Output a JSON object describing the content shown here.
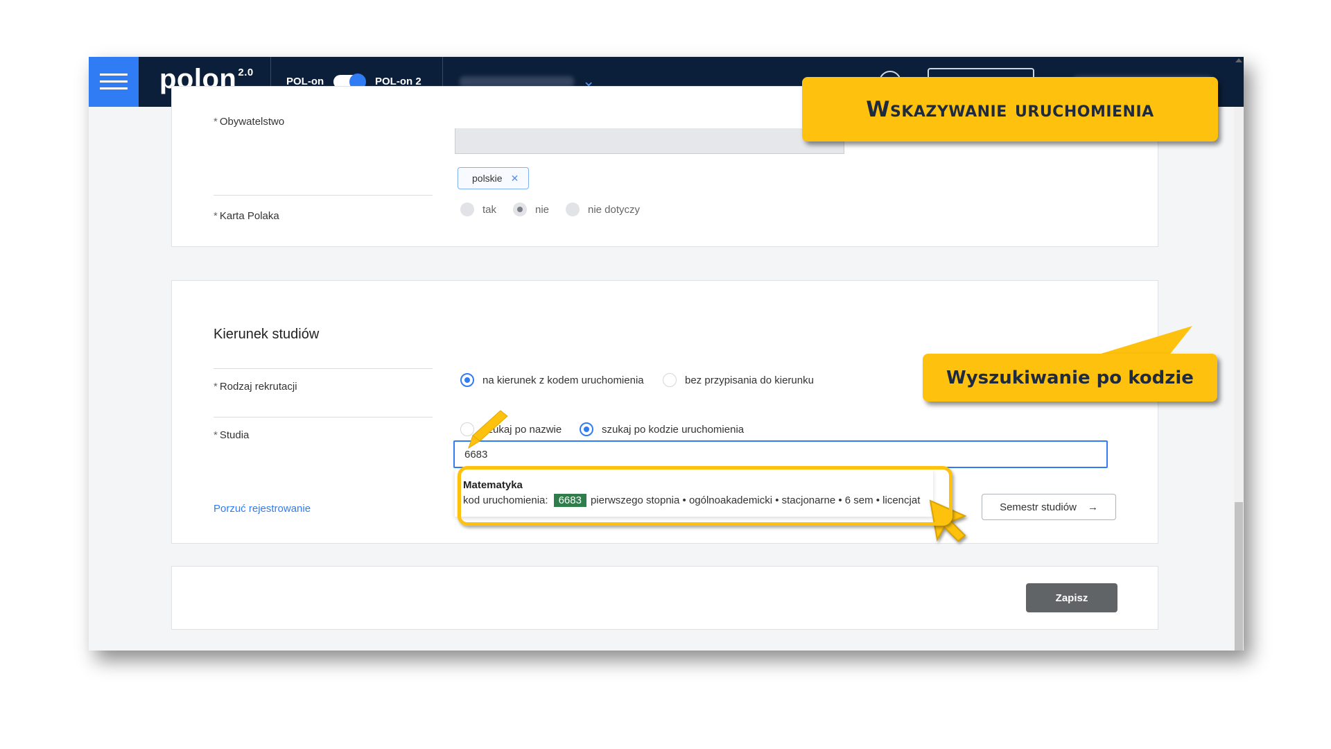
{
  "header": {
    "logo_text": "polon",
    "logo_version": "2.0",
    "toggle_left_label": "POL-on",
    "toggle_right_label": "POL-on 2"
  },
  "citizenship": {
    "label": "Obywatelstwo",
    "chip_value": "polskie"
  },
  "polish_card": {
    "label": "Karta Polaka",
    "options": [
      "tak",
      "nie",
      "nie dotyczy"
    ],
    "selected": "nie"
  },
  "study_direction": {
    "section_title": "Kierunek studiów",
    "recruitment_type_label": "Rodzaj rekrutacji",
    "recruitment_options": [
      "na kierunek z kodem uruchomienia",
      "bez przypisania do kierunku"
    ],
    "recruitment_selected": "na kierunek z kodem uruchomienia",
    "studies_label": "Studia",
    "search_mode_options": [
      "szukaj po nazwie",
      "szukaj po kodzie uruchomienia"
    ],
    "search_mode_selected": "szukaj po kodzie uruchomienia",
    "search_value": "6683",
    "result": {
      "name": "Matematyka",
      "code_label": "kod uruchomienia:",
      "code": "6683",
      "details": "pierwszego stopnia • ogólnoakademicki • stacjonarne • 6 sem • licencjat"
    },
    "abandon_link": "Porzuć rejestrowanie",
    "next_button": "Semestr studiów"
  },
  "footer": {
    "save_button": "Zapisz"
  },
  "annotations": {
    "title": "Wskazywanie uruchomienia",
    "subtitle": "Wyszukiwanie po kodzie",
    "color": "#fdc10e"
  },
  "colors": {
    "topbar": "#0c1f3a",
    "accent": "#2f7cf5",
    "code_badge": "#2e7d4a",
    "save_button": "#616467"
  }
}
